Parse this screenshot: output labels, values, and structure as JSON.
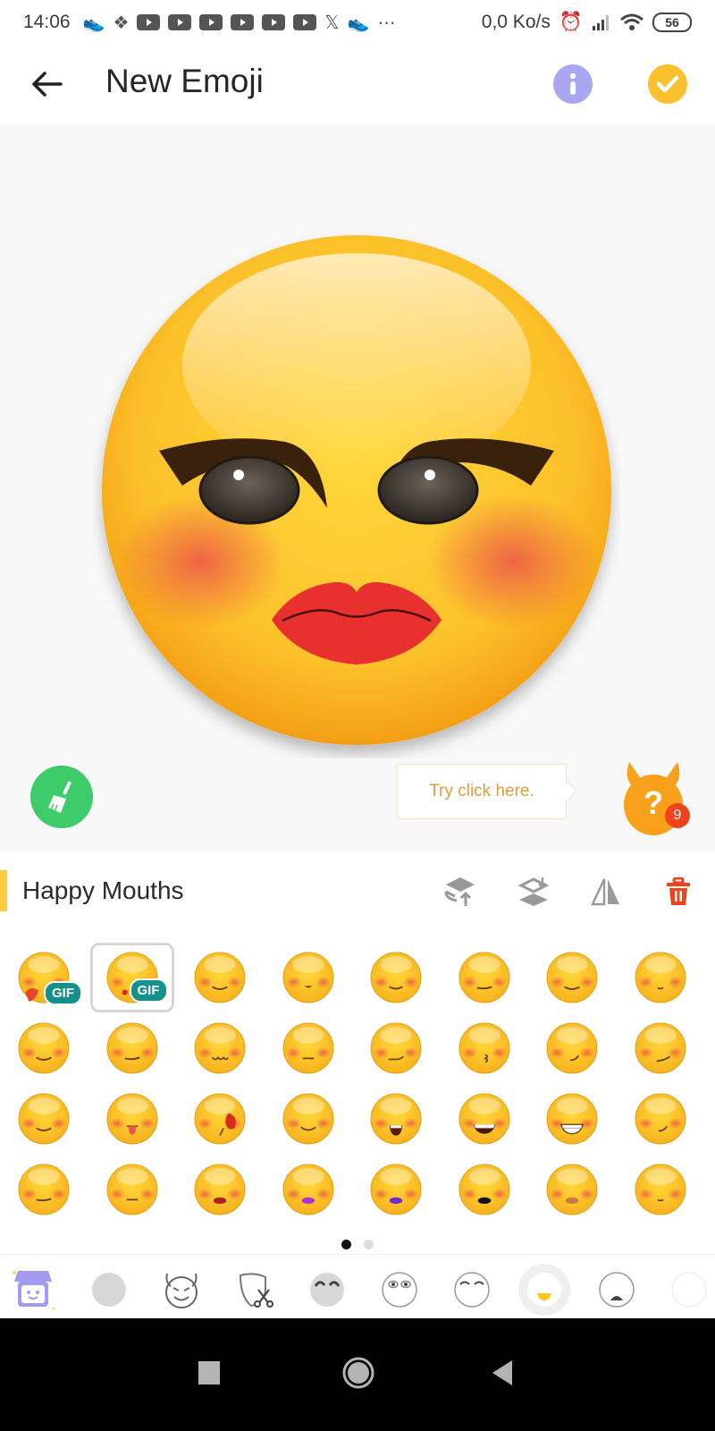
{
  "status_bar": {
    "time": "14:06",
    "network_speed": "0,0 Ko/s",
    "battery": "56",
    "more": "⋯"
  },
  "app_bar": {
    "title": "New Emoji",
    "back_icon": "arrow-left",
    "info_icon": "info",
    "confirm_icon": "check"
  },
  "canvas": {
    "preview": "emoji with winged eyeliner, brown eyes, blush cheeks, red lips",
    "colors": {
      "face": "#fcc52b",
      "lips": "#e8312e",
      "eyeliner": "#3a210c",
      "blush": "#ee6a4a"
    },
    "clear_button_icon": "broom",
    "tooltip": "Try click here.",
    "help_icon": "?",
    "help_badge_count": "9"
  },
  "section": {
    "title": "Happy Mouths",
    "tools": [
      {
        "name": "layer-up",
        "label": "Bring forward"
      },
      {
        "name": "layer-down",
        "label": "Send backward"
      },
      {
        "name": "flip",
        "label": "Flip"
      },
      {
        "name": "delete",
        "label": "Delete"
      }
    ],
    "accent_color": "#ffcc3e",
    "delete_color": "#f0421b"
  },
  "mouth_grid": {
    "gif_label": "GIF",
    "selected_index": 1,
    "items": [
      {
        "mouth": "fire",
        "gif": true
      },
      {
        "mouth": "kiss-gif",
        "gif": true
      },
      {
        "mouth": "smile"
      },
      {
        "mouth": "small-open"
      },
      {
        "mouth": "closed-smile"
      },
      {
        "mouth": "flat-smile"
      },
      {
        "mouth": "smile"
      },
      {
        "mouth": "small-smile"
      },
      {
        "mouth": "smile"
      },
      {
        "mouth": "flat-smile"
      },
      {
        "mouth": "wavy"
      },
      {
        "mouth": "flat"
      },
      {
        "mouth": "smirk"
      },
      {
        "mouth": "kiss"
      },
      {
        "mouth": "side-smile"
      },
      {
        "mouth": "side-smirk"
      },
      {
        "mouth": "smile"
      },
      {
        "mouth": "tongue"
      },
      {
        "mouth": "rose"
      },
      {
        "mouth": "content"
      },
      {
        "mouth": "open-laugh"
      },
      {
        "mouth": "grin"
      },
      {
        "mouth": "teeth-grin"
      },
      {
        "mouth": "side-smile"
      },
      {
        "mouth": "flat-smile"
      },
      {
        "mouth": "flat"
      },
      {
        "mouth": "red-lips"
      },
      {
        "mouth": "purple-lips"
      },
      {
        "mouth": "violet-lips"
      },
      {
        "mouth": "black-lips"
      },
      {
        "mouth": "nude-lips"
      },
      {
        "mouth": "small-smile"
      }
    ]
  },
  "pager": {
    "pages": 2,
    "current": 1
  },
  "tabs": {
    "selected_index": 7,
    "items": [
      {
        "name": "shop"
      },
      {
        "name": "face-base"
      },
      {
        "name": "devil"
      },
      {
        "name": "cut-shape"
      },
      {
        "name": "hair"
      },
      {
        "name": "eyes"
      },
      {
        "name": "eyebrows"
      },
      {
        "name": "mouth"
      },
      {
        "name": "mouth-alt"
      },
      {
        "name": "more"
      }
    ]
  },
  "nav_bar": {
    "recents": "recents",
    "home": "home",
    "back": "back"
  }
}
